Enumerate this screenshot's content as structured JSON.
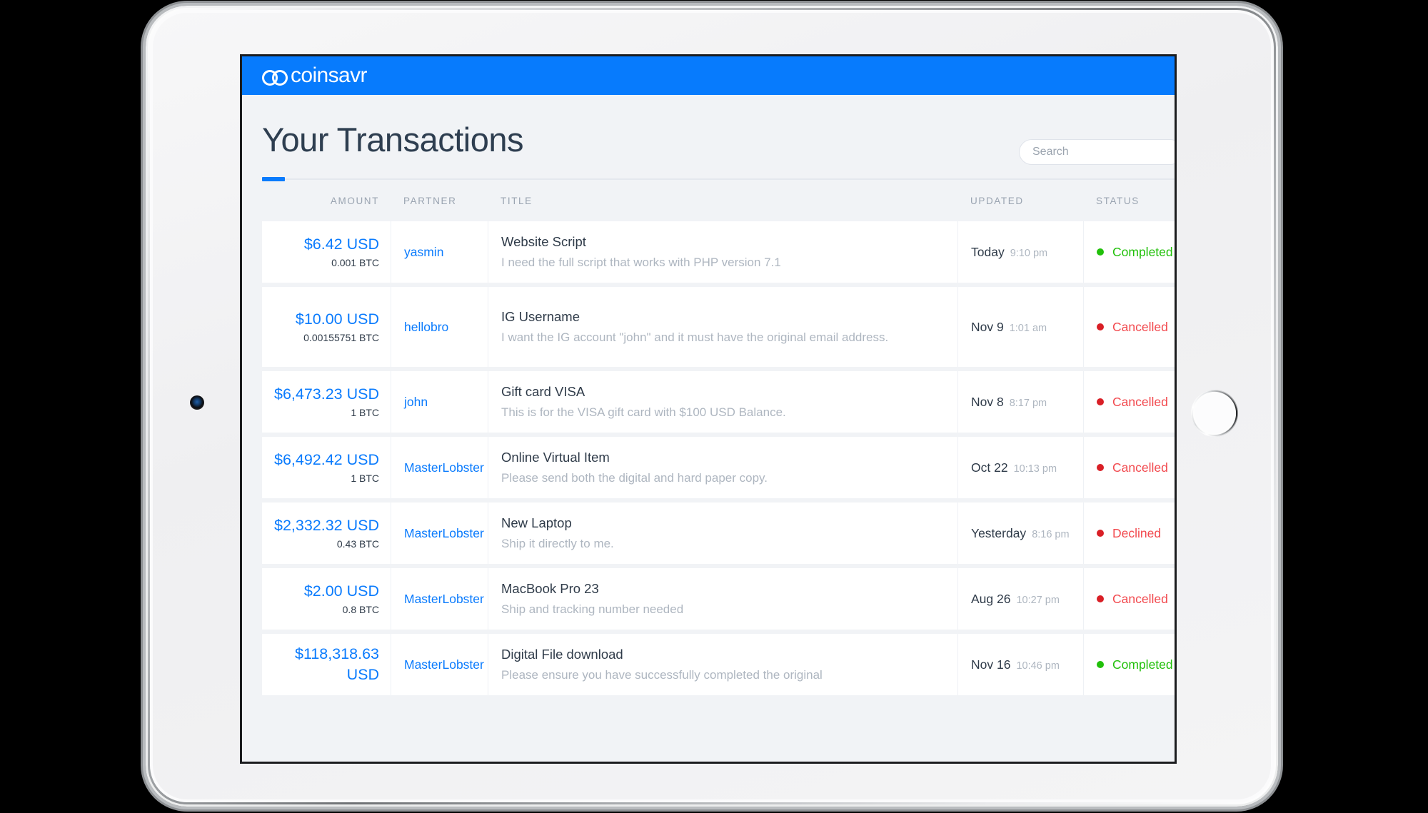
{
  "app": {
    "logo_text": "coinsavr",
    "header_color": "#077bfd"
  },
  "page": {
    "title": "Your Transactions",
    "accent_color": "#0a7bfd"
  },
  "search": {
    "placeholder": "Search",
    "value": ""
  },
  "table": {
    "headers": {
      "amount": "AMOUNT",
      "partner": "PARTNER",
      "title": "TITLE",
      "updated": "UPDATED",
      "status": "STATUS"
    },
    "rows": [
      {
        "amount_usd": "$6.42 USD",
        "amount_btc": "0.001 BTC",
        "partner": "yasmin",
        "title": "Website Script",
        "description": "I need the full script that works with PHP version 7.1",
        "updated_day": "Today",
        "updated_time": "9:10 pm",
        "status": "Completed",
        "status_color": "#21c00a",
        "status_dot_color": "#21c00a"
      },
      {
        "amount_usd": "$10.00 USD",
        "amount_btc": "0.00155751 BTC",
        "partner": "hellobro",
        "title": "IG Username",
        "description": "I want the IG account \"john\" and it must have the original email address.",
        "updated_day": "Nov 9",
        "updated_time": "1:01 am",
        "status": "Cancelled",
        "status_color": "#f24a4f",
        "status_dot_color": "#d91f26"
      },
      {
        "amount_usd": "$6,473.23 USD",
        "amount_btc": "1 BTC",
        "partner": "john",
        "title": "Gift card VISA",
        "description": "This is for the VISA gift card with $100 USD Balance.",
        "updated_day": "Nov 8",
        "updated_time": "8:17 pm",
        "status": "Cancelled",
        "status_color": "#f24a4f",
        "status_dot_color": "#d91f26"
      },
      {
        "amount_usd": "$6,492.42 USD",
        "amount_btc": "1 BTC",
        "partner": "MasterLobster",
        "title": "Online Virtual Item",
        "description": "Please send both the digital and hard paper copy.",
        "updated_day": "Oct 22",
        "updated_time": "10:13 pm",
        "status": "Cancelled",
        "status_color": "#f24a4f",
        "status_dot_color": "#d91f26"
      },
      {
        "amount_usd": "$2,332.32 USD",
        "amount_btc": "0.43 BTC",
        "partner": "MasterLobster",
        "title": "New Laptop",
        "description": "Ship it directly to me.",
        "updated_day": "Yesterday",
        "updated_time": "8:16 pm",
        "status": "Declined",
        "status_color": "#f24a4f",
        "status_dot_color": "#d91f26"
      },
      {
        "amount_usd": "$2.00 USD",
        "amount_btc": "0.8 BTC",
        "partner": "MasterLobster",
        "title": "MacBook Pro 23",
        "description": "Ship and tracking number needed",
        "updated_day": "Aug 26",
        "updated_time": "10:27 pm",
        "status": "Cancelled",
        "status_color": "#f24a4f",
        "status_dot_color": "#d91f26"
      },
      {
        "amount_usd": "$118,318.63 USD",
        "amount_btc": "",
        "partner": "MasterLobster",
        "title": "Digital File download",
        "description": "Please ensure you have successfully completed the original",
        "updated_day": "Nov 16",
        "updated_time": "10:46 pm",
        "status": "Completed",
        "status_color": "#21c00a",
        "status_dot_color": "#21c00a"
      }
    ]
  },
  "device": {
    "camera": "front-camera",
    "home_button": "home-button"
  }
}
